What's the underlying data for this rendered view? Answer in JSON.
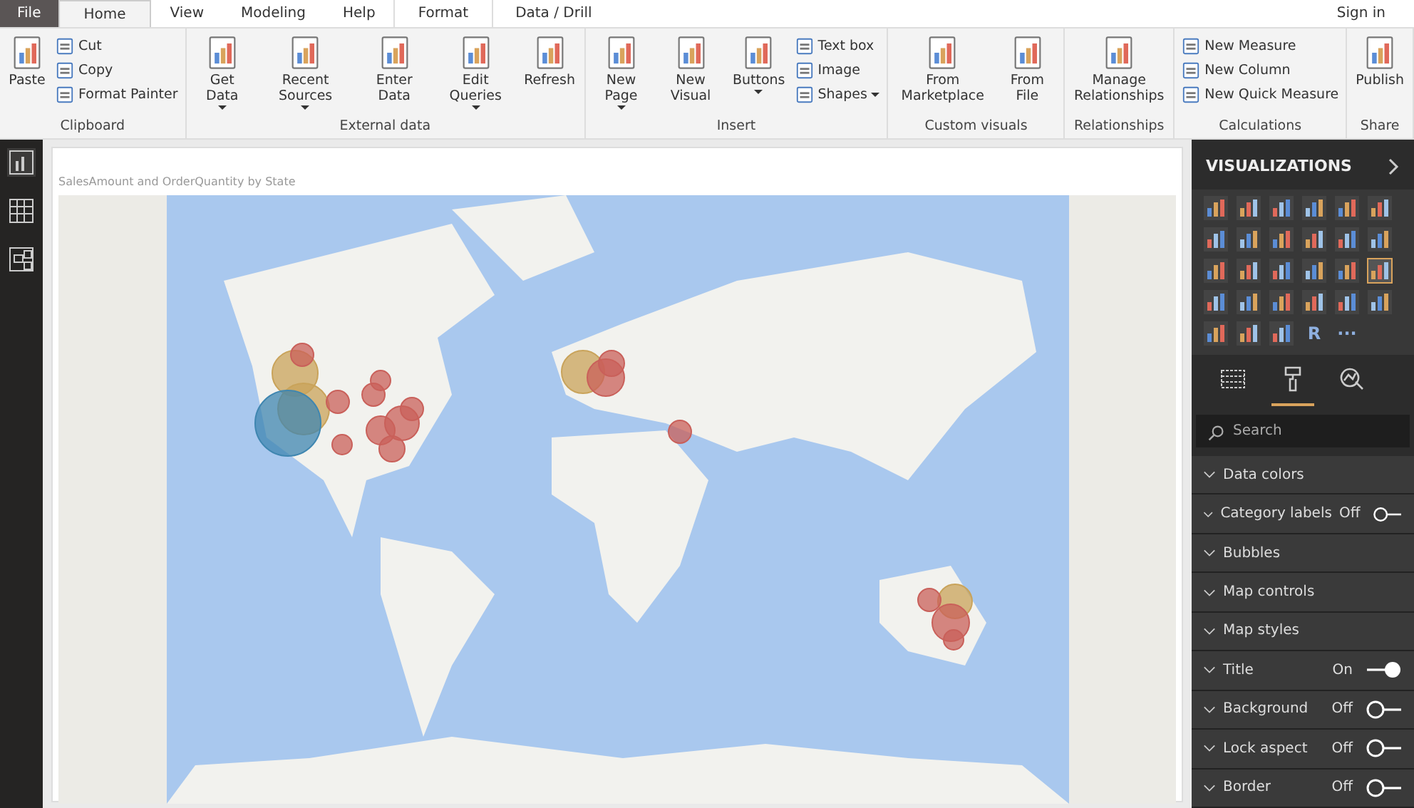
{
  "tabs": [
    {
      "label": "File",
      "kind": "file",
      "selected": false
    },
    {
      "label": "Home",
      "kind": "tab",
      "selected": true
    },
    {
      "label": "View",
      "kind": "tab",
      "selected": false
    },
    {
      "label": "Modeling",
      "kind": "tab",
      "selected": false
    },
    {
      "label": "Help",
      "kind": "tab",
      "selected": false
    },
    {
      "label": "Format",
      "kind": "context",
      "selected": false
    },
    {
      "label": "Data / Drill",
      "kind": "context",
      "selected": false
    }
  ],
  "sign_in": "Sign in",
  "ribbon": {
    "groups": [
      {
        "label": "Clipboard",
        "items": [
          {
            "kind": "large",
            "label": "Paste",
            "dropdown": false
          },
          {
            "kind": "small",
            "label": "Cut",
            "dropdown": false
          },
          {
            "kind": "small",
            "label": "Copy",
            "dropdown": false
          },
          {
            "kind": "small",
            "label": "Format Painter",
            "dropdown": false
          }
        ]
      },
      {
        "label": "External data",
        "items": [
          {
            "kind": "large",
            "label": "Get Data",
            "dropdown": true
          },
          {
            "kind": "large",
            "label": "Recent Sources",
            "dropdown": true
          },
          {
            "kind": "large",
            "label": "Enter Data",
            "dropdown": false
          },
          {
            "kind": "large",
            "label": "Edit Queries",
            "dropdown": true
          },
          {
            "kind": "large",
            "label": "Refresh",
            "dropdown": false
          }
        ]
      },
      {
        "label": "Insert",
        "items": [
          {
            "kind": "large",
            "label": "New Page",
            "dropdown": true
          },
          {
            "kind": "large",
            "label": "New Visual",
            "dropdown": false
          },
          {
            "kind": "large",
            "label": "Buttons",
            "dropdown": true
          },
          {
            "kind": "small",
            "label": "Text box",
            "dropdown": false
          },
          {
            "kind": "small",
            "label": "Image",
            "dropdown": false
          },
          {
            "kind": "small",
            "label": "Shapes",
            "dropdown": true
          }
        ]
      },
      {
        "label": "Custom visuals",
        "items": [
          {
            "kind": "large",
            "label": "From Marketplace",
            "dropdown": false
          },
          {
            "kind": "large",
            "label": "From File",
            "dropdown": false
          }
        ]
      },
      {
        "label": "Relationships",
        "items": [
          {
            "kind": "large",
            "label": "Manage Relationships",
            "dropdown": false
          }
        ]
      },
      {
        "label": "Calculations",
        "items": [
          {
            "kind": "small",
            "label": "New Measure",
            "dropdown": false
          },
          {
            "kind": "small",
            "label": "New Column",
            "dropdown": false
          },
          {
            "kind": "small",
            "label": "New Quick Measure",
            "dropdown": false
          }
        ]
      },
      {
        "label": "Share",
        "items": [
          {
            "kind": "large",
            "label": "Publish",
            "dropdown": false
          }
        ]
      }
    ]
  },
  "nav": [
    {
      "kind": "report",
      "selected": true
    },
    {
      "kind": "data",
      "selected": false
    },
    {
      "kind": "model",
      "selected": false
    }
  ],
  "visual": {
    "title": "SalesAmount and OrderQuantity by State"
  },
  "pane": {
    "title": "VISUALIZATIONS",
    "visuals": [
      {
        "kind": "icon",
        "selected": false
      },
      {
        "kind": "icon",
        "selected": false
      },
      {
        "kind": "icon",
        "selected": false
      },
      {
        "kind": "icon",
        "selected": false
      },
      {
        "kind": "icon",
        "selected": false
      },
      {
        "kind": "icon",
        "selected": false
      },
      {
        "kind": "icon",
        "selected": false
      },
      {
        "kind": "icon",
        "selected": false
      },
      {
        "kind": "icon",
        "selected": false
      },
      {
        "kind": "icon",
        "selected": false
      },
      {
        "kind": "icon",
        "selected": false
      },
      {
        "kind": "icon",
        "selected": false
      },
      {
        "kind": "icon",
        "selected": false
      },
      {
        "kind": "icon",
        "selected": false
      },
      {
        "kind": "icon",
        "selected": false
      },
      {
        "kind": "icon",
        "selected": false
      },
      {
        "kind": "icon",
        "selected": false
      },
      {
        "kind": "icon",
        "selected": true
      },
      {
        "kind": "icon",
        "selected": false
      },
      {
        "kind": "icon",
        "selected": false
      },
      {
        "kind": "icon",
        "selected": false
      },
      {
        "kind": "icon",
        "selected": false
      },
      {
        "kind": "icon",
        "selected": false
      },
      {
        "kind": "icon",
        "selected": false
      },
      {
        "kind": "icon",
        "selected": false
      },
      {
        "kind": "icon",
        "selected": false
      },
      {
        "kind": "icon",
        "selected": false
      },
      {
        "kind": "text",
        "text": "R",
        "selected": false
      },
      {
        "kind": "text",
        "text": "···",
        "selected": false
      }
    ],
    "pane_tabs": [
      {
        "kind": "fields",
        "selected": false
      },
      {
        "kind": "format",
        "selected": true
      },
      {
        "kind": "analytics",
        "selected": false
      }
    ],
    "search": {
      "placeholder": "Search"
    },
    "sections": [
      {
        "label": "Data colors"
      },
      {
        "label": "Category labels",
        "toggle": {
          "label": "Off",
          "on": false
        }
      },
      {
        "label": "Bubbles"
      },
      {
        "label": "Map controls"
      },
      {
        "label": "Map styles"
      },
      {
        "label": "Title",
        "toggle": {
          "label": "On",
          "on": true
        }
      },
      {
        "label": "Background",
        "toggle": {
          "label": "Off",
          "on": false
        }
      },
      {
        "label": "Lock aspect",
        "toggle": {
          "label": "Off",
          "on": false
        }
      },
      {
        "label": "Border",
        "toggle": {
          "label": "Off",
          "on": false
        }
      }
    ]
  }
}
